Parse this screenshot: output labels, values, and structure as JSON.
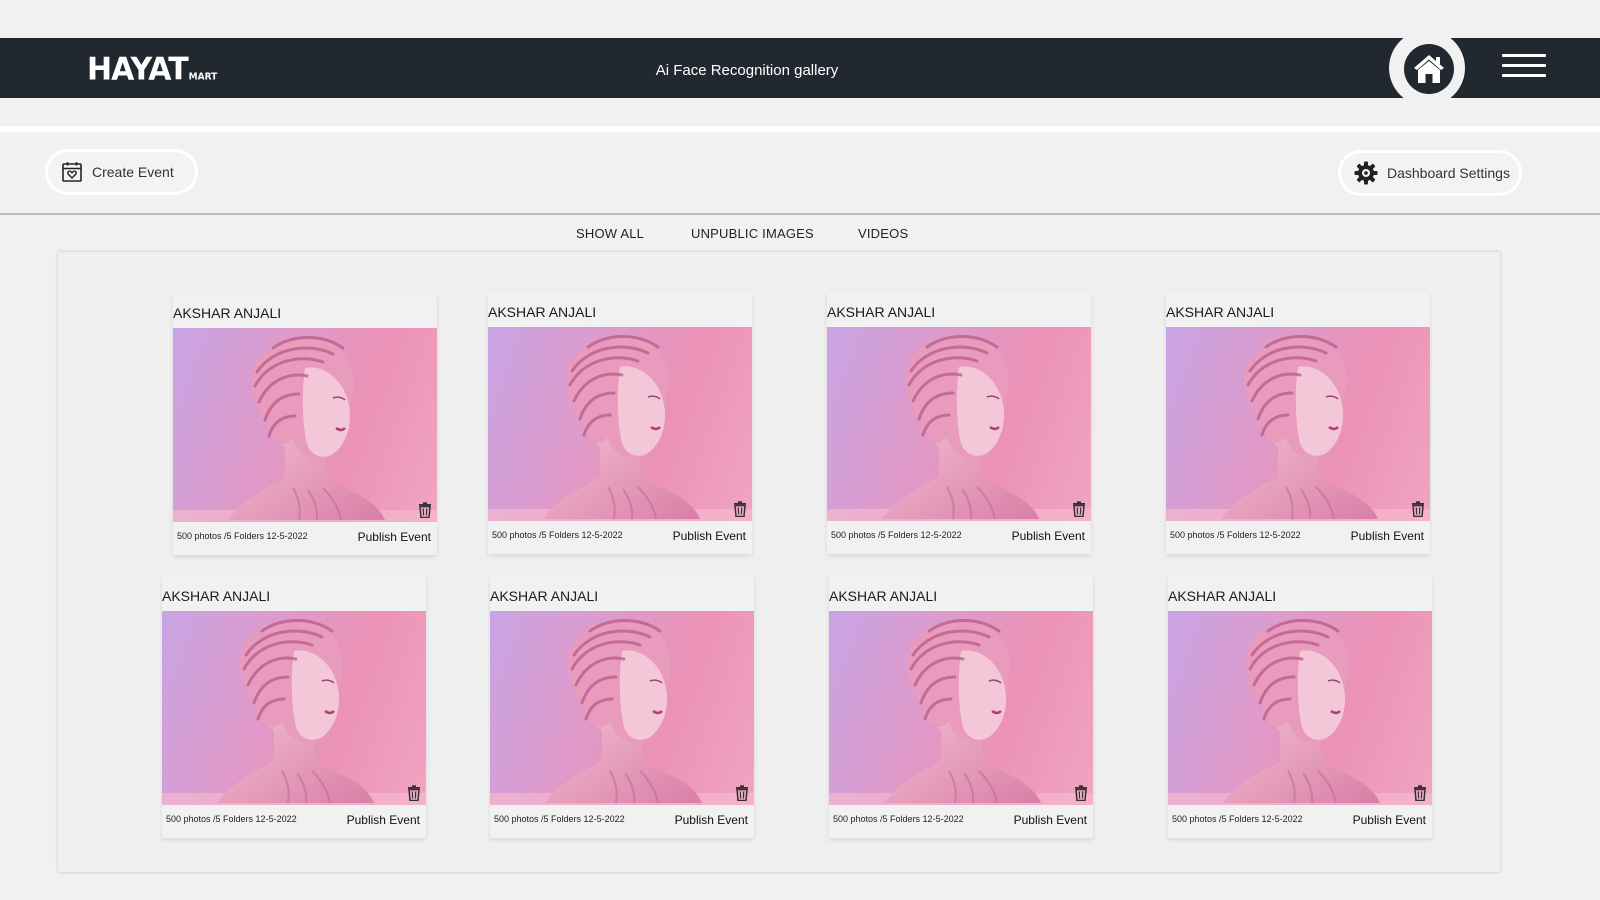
{
  "header": {
    "logo_main": "HAYAT",
    "logo_sub": "MART",
    "title": "Ai Face Recognition gallery",
    "home_icon": "home-icon",
    "menu_icon": "hamburger-menu-icon"
  },
  "toolbar": {
    "create_event_label": "Create Event",
    "create_event_icon": "calendar-heart-icon",
    "dashboard_settings_label": "Dashboard Settings",
    "dashboard_settings_icon": "gear-icon"
  },
  "tabs": [
    {
      "label": "SHOW ALL"
    },
    {
      "label": "UNPUBLIC IMAGES"
    },
    {
      "label": "VIDEOS"
    }
  ],
  "colors": {
    "header_bg": "#212830",
    "page_bg": "#f1f1f1",
    "image_gradient_start": "#c8a4e4",
    "image_gradient_end": "#f1a4c2"
  },
  "events": [
    {
      "title": "AKSHAR ANJALI",
      "meta": "500 photos /5 Folders 12-5-2022",
      "action": "Publish Event"
    },
    {
      "title": "AKSHAR ANJALI",
      "meta": "500 photos /5 Folders 12-5-2022",
      "action": "Publish Event"
    },
    {
      "title": "AKSHAR ANJALI",
      "meta": "500 photos /5 Folders 12-5-2022",
      "action": "Publish Event"
    },
    {
      "title": "AKSHAR ANJALI",
      "meta": "500 photos /5 Folders 12-5-2022",
      "action": "Publish Event"
    },
    {
      "title": "AKSHAR ANJALI",
      "meta": "500 photos /5 Folders 12-5-2022",
      "action": "Publish Event"
    },
    {
      "title": "AKSHAR ANJALI",
      "meta": "500 photos /5 Folders 12-5-2022",
      "action": "Publish Event"
    },
    {
      "title": "AKSHAR ANJALI",
      "meta": "500 photos /5 Folders 12-5-2022",
      "action": "Publish Event"
    },
    {
      "title": "AKSHAR ANJALI",
      "meta": "500 photos /5 Folders 12-5-2022",
      "action": "Publish Event"
    }
  ]
}
